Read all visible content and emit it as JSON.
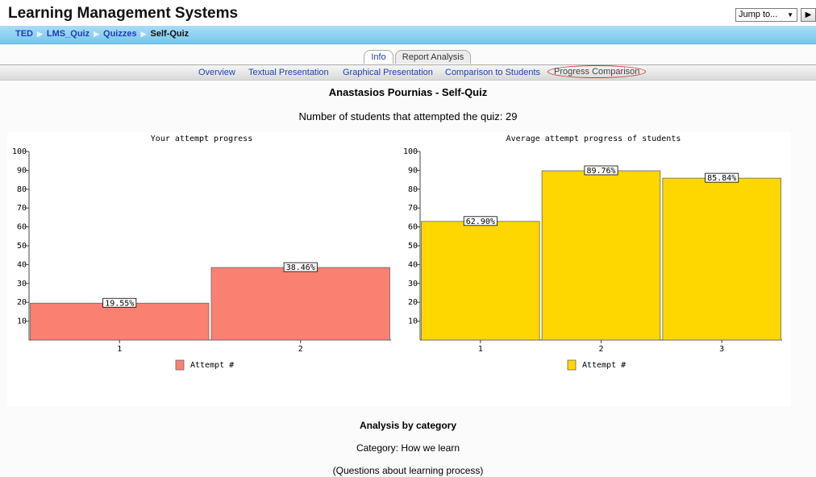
{
  "header": {
    "site_title": "Learning Management Systems",
    "jump_label": "Jump to...",
    "go_glyph": "▶"
  },
  "breadcrumb": {
    "items": [
      "TED",
      "LMS_Quiz",
      "Quizzes"
    ],
    "separator": "▶",
    "current": "Self-Quiz"
  },
  "tabs": [
    {
      "label": "Info"
    },
    {
      "label": "Report Analysis"
    }
  ],
  "subtabs": [
    {
      "label": "Overview"
    },
    {
      "label": "Textual Presentation"
    },
    {
      "label": "Graphical Presentation"
    },
    {
      "label": "Comparison to Students"
    },
    {
      "label": "Progress Comparison",
      "selected": true
    }
  ],
  "main": {
    "title": "Anastasios Pournias - Self-Quiz",
    "attempts_text": "Number of students that attempted the quiz: 29"
  },
  "chart_data": [
    {
      "type": "bar",
      "title": "Your attempt progress",
      "categories": [
        "1",
        "2"
      ],
      "series": [
        {
          "name": "Attempt #",
          "values": [
            19.55,
            38.46
          ]
        }
      ],
      "data_labels": [
        "19.55%",
        "38.46%"
      ],
      "ylim": [
        0,
        100
      ],
      "yticks": [
        10,
        20,
        30,
        40,
        50,
        60,
        70,
        80,
        90,
        100
      ],
      "color": "#fa8072",
      "legend": "bottom"
    },
    {
      "type": "bar",
      "title": "Average attempt progress of students",
      "categories": [
        "1",
        "2",
        "3"
      ],
      "series": [
        {
          "name": "Attempt #",
          "values": [
            62.9,
            89.76,
            85.84
          ]
        }
      ],
      "data_labels": [
        "62.90%",
        "89.76%",
        "85.84%"
      ],
      "ylim": [
        0,
        100
      ],
      "yticks": [
        10,
        20,
        30,
        40,
        50,
        60,
        70,
        80,
        90,
        100
      ],
      "color": "#ffd700",
      "legend": "bottom"
    }
  ],
  "analysis": {
    "heading": "Analysis by category",
    "category": "Category: How we learn",
    "description": "(Questions about learning process)"
  }
}
